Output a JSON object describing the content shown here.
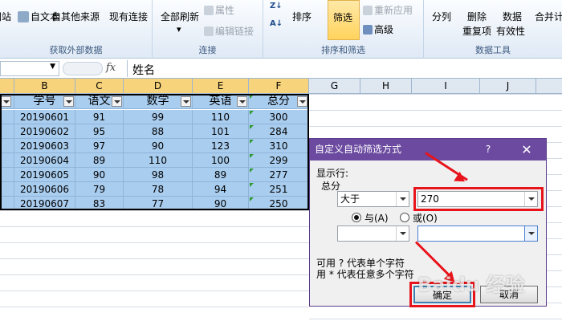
{
  "ribbon": {
    "groups": [
      {
        "label": "获取外部数据",
        "buttons": [
          "网站",
          "自文本",
          "自其他来源",
          "现有连接"
        ]
      },
      {
        "label": "连接",
        "buttons": [
          "全部刷新",
          "属性",
          "编辑链接"
        ]
      },
      {
        "label": "排序和筛选",
        "buttons": [
          "排序",
          "筛选",
          "重新应用",
          "高级"
        ]
      },
      {
        "label": "数据工具",
        "buttons": [
          "分列",
          "删除",
          "重复项",
          "数据",
          "有效性",
          "合并计"
        ]
      }
    ],
    "sort_az": "Z↓A",
    "sort_za": "Z↓A"
  },
  "formula_bar": {
    "fx": "fx",
    "content": "姓名"
  },
  "columns": [
    "B",
    "C",
    "D",
    "E",
    "F",
    "G",
    "H",
    "I",
    "J"
  ],
  "table": {
    "headers": [
      "学号",
      "语文",
      "数学",
      "英语",
      "总分"
    ],
    "rows": [
      [
        "20190601",
        "91",
        "99",
        "110",
        "300"
      ],
      [
        "20190602",
        "95",
        "88",
        "101",
        "284"
      ],
      [
        "20190603",
        "97",
        "90",
        "123",
        "310"
      ],
      [
        "20190604",
        "89",
        "110",
        "100",
        "299"
      ],
      [
        "20190605",
        "90",
        "98",
        "89",
        "277"
      ],
      [
        "20190606",
        "79",
        "78",
        "94",
        "251"
      ],
      [
        "20190607",
        "83",
        "77",
        "90",
        "250"
      ]
    ]
  },
  "dialog": {
    "title": "自定义自动筛选方式",
    "help": "?",
    "close": "✕",
    "show_rows_label": "显示行:",
    "field_label": "总分",
    "op1": "大于",
    "val1": "270",
    "and_label": "与(A)",
    "or_label": "或(O)",
    "op2": "",
    "val2": "",
    "hint1": "可用 ? 代表单个字符",
    "hint2": "用 * 代表任意多个字符",
    "ok": "确定",
    "cancel": "取消"
  },
  "watermark": "Baidu 经验",
  "colors": {
    "selection": "#a9cdef",
    "dialog_title": "#6b4aa0",
    "annotation": "#e8141b"
  }
}
